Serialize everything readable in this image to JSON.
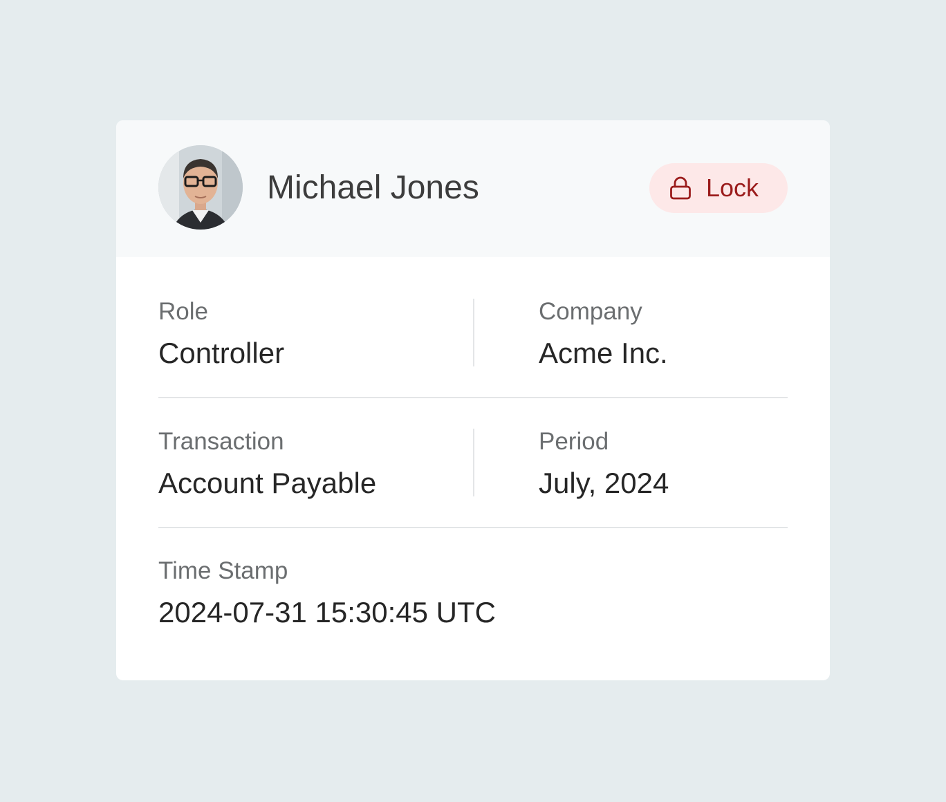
{
  "profile": {
    "name": "Michael Jones",
    "avatar_alt": "Michael Jones"
  },
  "lock_button": {
    "label": "Lock",
    "icon": "lock-icon"
  },
  "fields": {
    "role": {
      "label": "Role",
      "value": "Controller"
    },
    "company": {
      "label": "Company",
      "value": "Acme Inc."
    },
    "transaction": {
      "label": "Transaction",
      "value": "Account Payable"
    },
    "period": {
      "label": "Period",
      "value": "July, 2024"
    },
    "timestamp": {
      "label": "Time Stamp",
      "value": "2024-07-31 15:30:45 UTC"
    }
  },
  "colors": {
    "page_background": "#e5ecee",
    "card_background": "#ffffff",
    "header_background": "#f7f9fa",
    "lock_background": "#fde8e8",
    "lock_accent": "#9b1c1c"
  }
}
